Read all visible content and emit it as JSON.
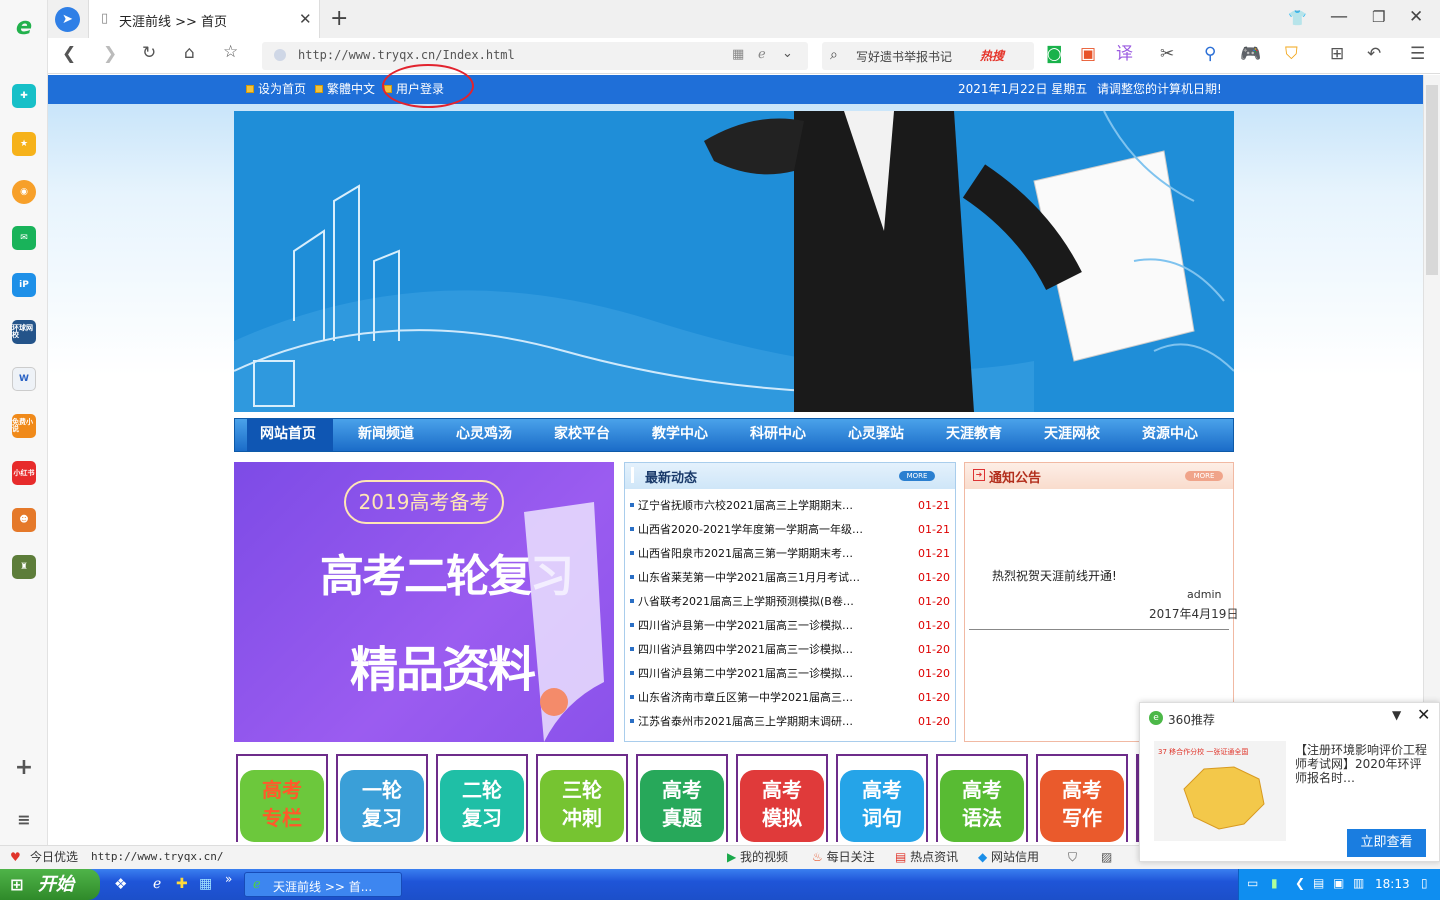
{
  "browser": {
    "tab_title": "天涯前线 >> 首页",
    "address": "http://www.tryqx.cn/Index.html",
    "search_placeholder": "写好遗书举报书记",
    "hot_label": "热搜"
  },
  "site": {
    "top_links": [
      "设为首页",
      "繁體中文",
      "用户登录"
    ],
    "date_text": "2021年1月22日  星期五",
    "date_hint": "请调整您的计算机日期!",
    "nav": [
      "网站首页",
      "新闻频道",
      "心灵鸡汤",
      "家校平台",
      "教学中心",
      "科研中心",
      "心灵驿站",
      "天涯教育",
      "天涯网校",
      "资源中心"
    ],
    "promo": {
      "year_tag": "2019高考备考",
      "line1": "高考二轮复习",
      "line2": "精品资料"
    },
    "news": {
      "title": "最新动态",
      "more": "MORE",
      "items": [
        {
          "title": "辽宁省抚顺市六校2021届高三上学期期末…",
          "date": "01-21"
        },
        {
          "title": "山西省2020-2021学年度第一学期高一年级…",
          "date": "01-21"
        },
        {
          "title": "山西省阳泉市2021届高三第一学期期末考…",
          "date": "01-21"
        },
        {
          "title": "山东省莱芜第一中学2021届高三1月月考试…",
          "date": "01-20"
        },
        {
          "title": "八省联考2021届高三上学期预测模拟(B卷…",
          "date": "01-20"
        },
        {
          "title": "四川省泸县第一中学2021届高三一诊模拟…",
          "date": "01-20"
        },
        {
          "title": "四川省泸县第四中学2021届高三一诊模拟…",
          "date": "01-20"
        },
        {
          "title": "四川省泸县第二中学2021届高三一诊模拟…",
          "date": "01-20"
        },
        {
          "title": "山东省济南市章丘区第一中学2021届高三…",
          "date": "01-20"
        },
        {
          "title": "江苏省泰州市2021届高三上学期期末调研…",
          "date": "01-20"
        }
      ]
    },
    "notice": {
      "title": "通知公告",
      "more": "MORE",
      "message": "热烈祝贺天涯前线开通!",
      "author": "admin",
      "date": "2017年4月19日"
    },
    "tiles": [
      {
        "l1": "高考",
        "l2": "专栏",
        "color": "#6cc83c",
        "fg": "#ff5a2a"
      },
      {
        "l1": "一轮",
        "l2": "复习",
        "color": "#3a9fd8",
        "fg": "#ffffff"
      },
      {
        "l1": "二轮",
        "l2": "复习",
        "color": "#1fbfa6",
        "fg": "#ffffff"
      },
      {
        "l1": "三轮",
        "l2": "冲刺",
        "color": "#76c431",
        "fg": "#ffffff"
      },
      {
        "l1": "高考",
        "l2": "真题",
        "color": "#27a85a",
        "fg": "#ffffff"
      },
      {
        "l1": "高考",
        "l2": "模拟",
        "color": "#e03a3a",
        "fg": "#ffffff"
      },
      {
        "l1": "高考",
        "l2": "词句",
        "color": "#25a4e8",
        "fg": "#ffffff"
      },
      {
        "l1": "高考",
        "l2": "语法",
        "color": "#58bb33",
        "fg": "#ffffff"
      },
      {
        "l1": "高考",
        "l2": "写作",
        "color": "#ea5a2c",
        "fg": "#ffffff"
      }
    ]
  },
  "statusbar": {
    "left_label": "今日优选",
    "url": "http://www.tryqx.cn/",
    "items": [
      "我的视频",
      "每日关注",
      "热点资讯",
      "网站信用"
    ]
  },
  "popup": {
    "title": "360推荐",
    "thumb_caption": "37 移合作分校 一张证通全国",
    "text": "【注册环境影响评价工程师考试网】2020年环评师报名时…",
    "button": "立即查看"
  },
  "taskbar": {
    "start": "开始",
    "task": "天涯前线 >> 首...",
    "time": "18:13"
  },
  "sidebar": {
    "labels": [
      "环球网校",
      "免费小说",
      "小红书"
    ]
  }
}
